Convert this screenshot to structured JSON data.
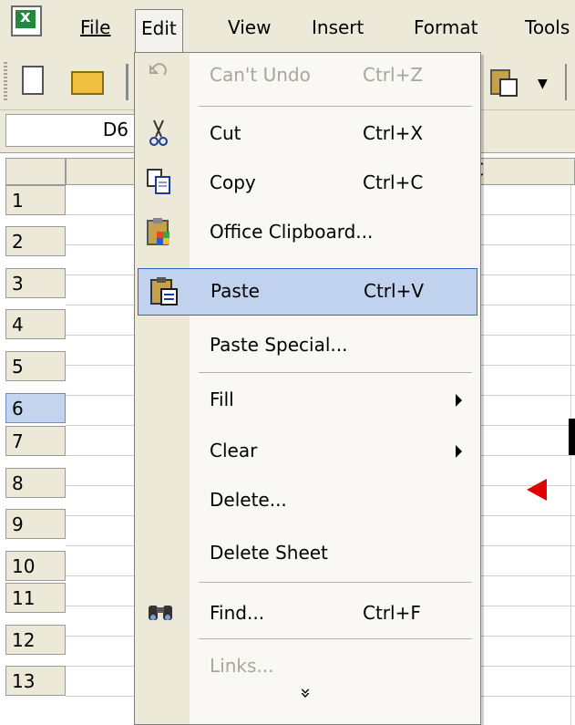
{
  "menubar": {
    "items": [
      {
        "label": "File"
      },
      {
        "label": "Edit"
      },
      {
        "label": "View"
      },
      {
        "label": "Insert"
      },
      {
        "label": "Format"
      },
      {
        "label": "Tools"
      }
    ]
  },
  "formula_bar": {
    "name_box": "D6"
  },
  "column_headers": {
    "partial": "C"
  },
  "rows": [
    "1",
    "2",
    "3",
    "4",
    "5",
    "6",
    "7",
    "8",
    "9",
    "10",
    "11",
    "12",
    "13"
  ],
  "selected_row": "6",
  "edit_menu": {
    "items": [
      {
        "label": "Can't Undo",
        "shortcut": "Ctrl+Z",
        "enabled": false,
        "icon": "undo-icon"
      },
      {
        "label": "Cut",
        "shortcut": "Ctrl+X",
        "enabled": true,
        "icon": "scissors-icon"
      },
      {
        "label": "Copy",
        "shortcut": "Ctrl+C",
        "enabled": true,
        "icon": "copy-icon"
      },
      {
        "label": "Office Clipboard...",
        "shortcut": "",
        "enabled": true,
        "icon": "office-clipboard-icon"
      },
      {
        "label": "Paste",
        "shortcut": "Ctrl+V",
        "enabled": true,
        "icon": "paste-icon",
        "highlighted": true
      },
      {
        "label": "Paste Special...",
        "shortcut": "",
        "enabled": true
      },
      {
        "label": "Fill",
        "submenu": true,
        "enabled": true
      },
      {
        "label": "Clear",
        "submenu": true,
        "enabled": true
      },
      {
        "label": "Delete...",
        "enabled": true
      },
      {
        "label": "Delete Sheet",
        "enabled": true
      },
      {
        "label": "Find...",
        "shortcut": "Ctrl+F",
        "enabled": true,
        "icon": "binoculars-icon"
      },
      {
        "label": "Links...",
        "enabled": false
      }
    ],
    "expand_glyph": "»"
  },
  "colors": {
    "menu_highlight": "#c1d2ee",
    "highlight_border": "#316ac5",
    "disabled_text": "#a8a59b",
    "annotation_arrow": "#e30000"
  }
}
